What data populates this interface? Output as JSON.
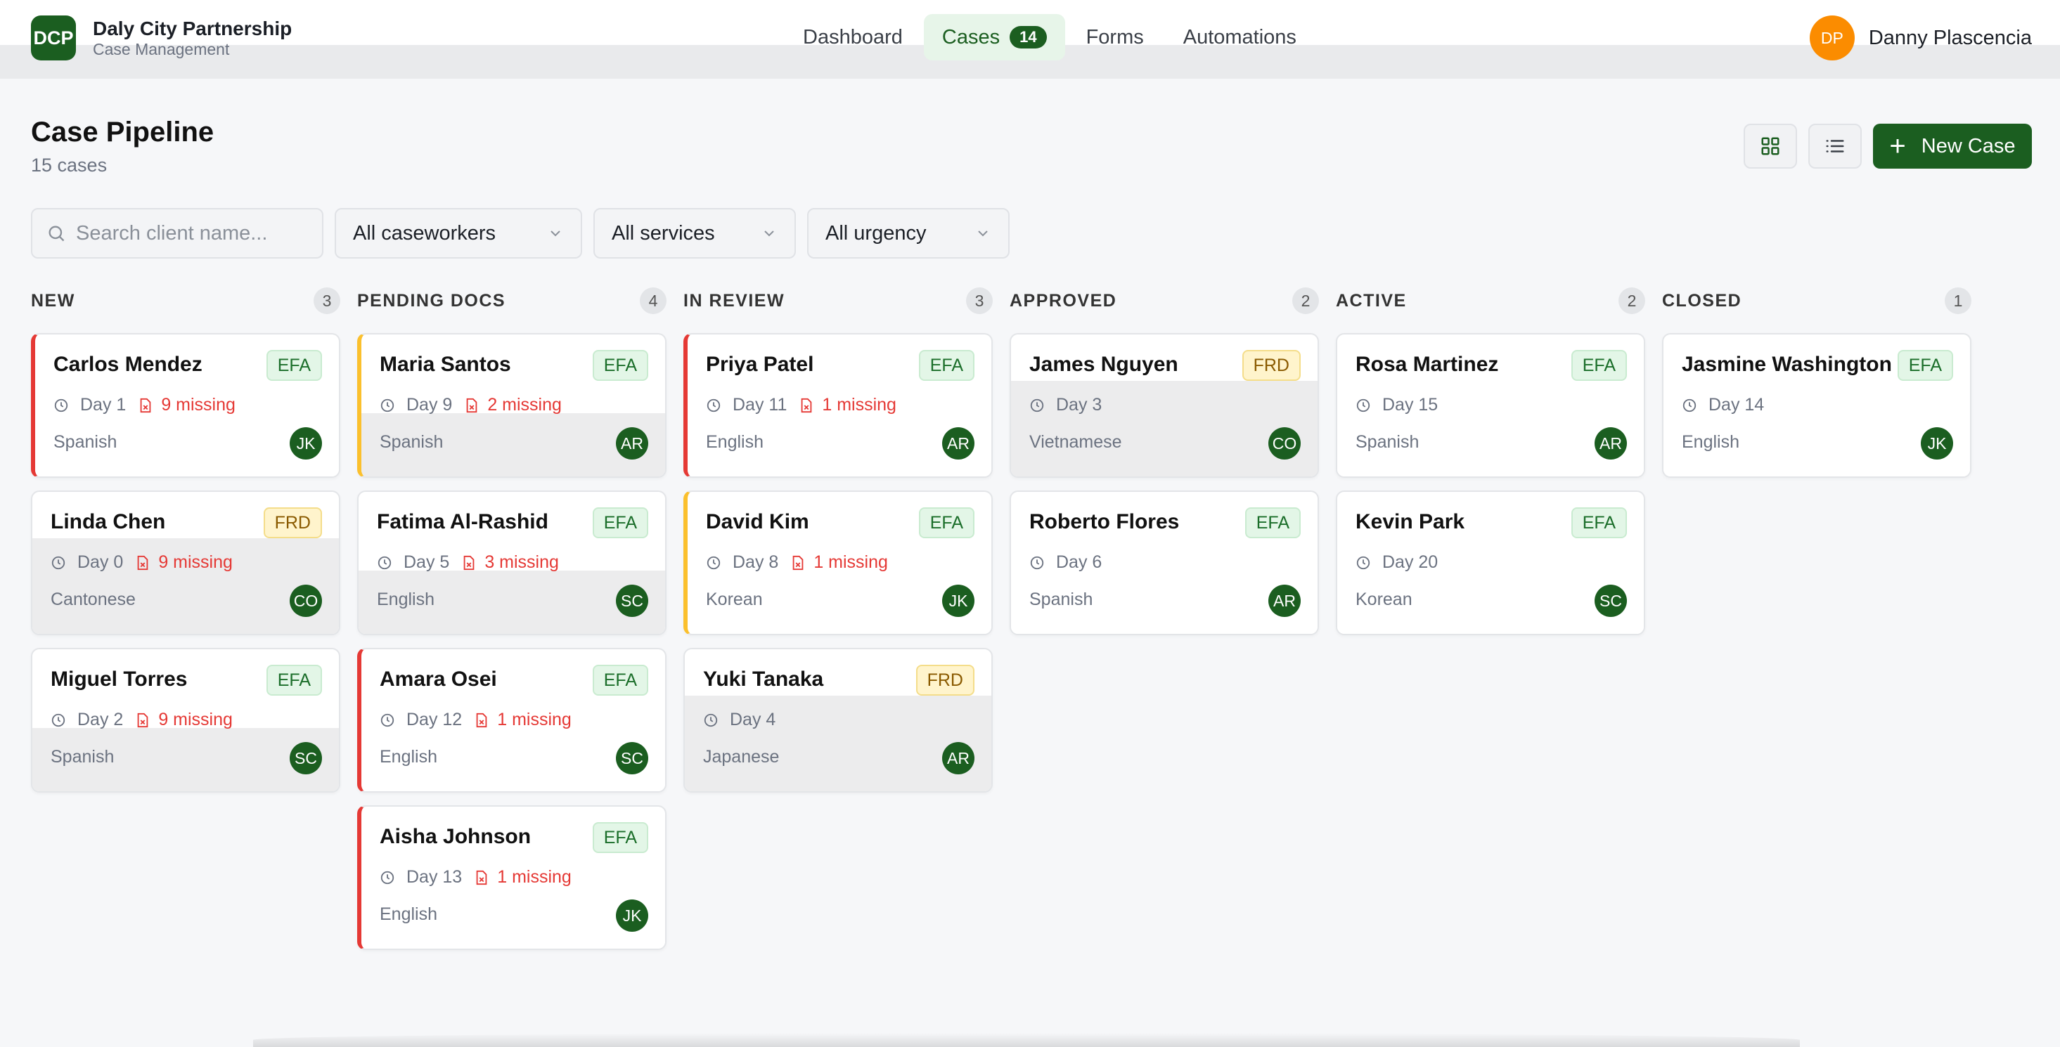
{
  "header": {
    "logo_text": "DCP",
    "org_name": "Daly City Partnership",
    "org_sub": "Case Management",
    "nav": [
      {
        "label": "Dashboard"
      },
      {
        "label": "Cases",
        "badge": "14"
      },
      {
        "label": "Forms"
      },
      {
        "label": "Automations"
      }
    ],
    "user": {
      "initials": "DP",
      "name": "Danny Plascencia"
    }
  },
  "page": {
    "title": "Case Pipeline",
    "count": "15 cases",
    "new_case_label": "New Case",
    "grid_view_icon": "grid-view-icon",
    "list_view_icon": "list-view-icon"
  },
  "filters": {
    "search_placeholder": "Search client name...",
    "caseworkers": "All caseworkers",
    "services": "All services",
    "urgency": "All urgency"
  },
  "columns": [
    {
      "name": "NEW",
      "count": "3"
    },
    {
      "name": "PENDING DOCS",
      "count": "4"
    },
    {
      "name": "IN REVIEW",
      "count": "3"
    },
    {
      "name": "APPROVED",
      "count": "2"
    },
    {
      "name": "ACTIVE",
      "count": "2"
    },
    {
      "name": "CLOSED",
      "count": "1"
    }
  ],
  "cards": {
    "c0": [
      {
        "name": "Carlos Mendez",
        "service": "EFA",
        "day": "Day 1",
        "missing": "9 missing",
        "language": "Spanish",
        "worker": "JK"
      },
      {
        "name": "Linda Chen",
        "service": "FRD",
        "day": "Day 0",
        "missing": "9 missing",
        "language": "Cantonese",
        "worker": "CO"
      },
      {
        "name": "Miguel Torres",
        "service": "EFA",
        "day": "Day 2",
        "missing": "9 missing",
        "language": "Spanish",
        "worker": "SC"
      }
    ],
    "c1": [
      {
        "name": "Maria Santos",
        "service": "EFA",
        "day": "Day 9",
        "missing": "2 missing",
        "language": "Spanish",
        "worker": "AR"
      },
      {
        "name": "Fatima Al-Rashid",
        "service": "EFA",
        "day": "Day 5",
        "missing": "3 missing",
        "language": "English",
        "worker": "SC"
      },
      {
        "name": "Amara Osei",
        "service": "EFA",
        "day": "Day 12",
        "missing": "1 missing",
        "language": "English",
        "worker": "SC"
      },
      {
        "name": "Aisha Johnson",
        "service": "EFA",
        "day": "Day 13",
        "missing": "1 missing",
        "language": "English",
        "worker": "JK"
      }
    ],
    "c2": [
      {
        "name": "Priya Patel",
        "service": "EFA",
        "day": "Day 11",
        "missing": "1 missing",
        "language": "English",
        "worker": "AR"
      },
      {
        "name": "David Kim",
        "service": "EFA",
        "day": "Day 8",
        "missing": "1 missing",
        "language": "Korean",
        "worker": "JK"
      },
      {
        "name": "Yuki Tanaka",
        "service": "FRD",
        "day": "Day 4",
        "language": "Japanese",
        "worker": "AR"
      }
    ],
    "c3": [
      {
        "name": "James Nguyen",
        "service": "FRD",
        "day": "Day 3",
        "language": "Vietnamese",
        "worker": "CO"
      },
      {
        "name": "Roberto Flores",
        "service": "EFA",
        "day": "Day 6",
        "language": "Spanish",
        "worker": "AR"
      }
    ],
    "c4": [
      {
        "name": "Rosa Martinez",
        "service": "EFA",
        "day": "Day 15",
        "language": "Spanish",
        "worker": "AR"
      },
      {
        "name": "Kevin Park",
        "service": "EFA",
        "day": "Day 20",
        "language": "Korean",
        "worker": "SC"
      }
    ],
    "c5": [
      {
        "name": "Jasmine Washington",
        "service": "EFA",
        "day": "Day 14",
        "language": "English",
        "worker": "JK"
      }
    ]
  },
  "colors": {
    "brand": "#1b5e20",
    "urgent": "#e53935",
    "warning": "#fbc02d",
    "user_avatar": "#fb8c00"
  }
}
